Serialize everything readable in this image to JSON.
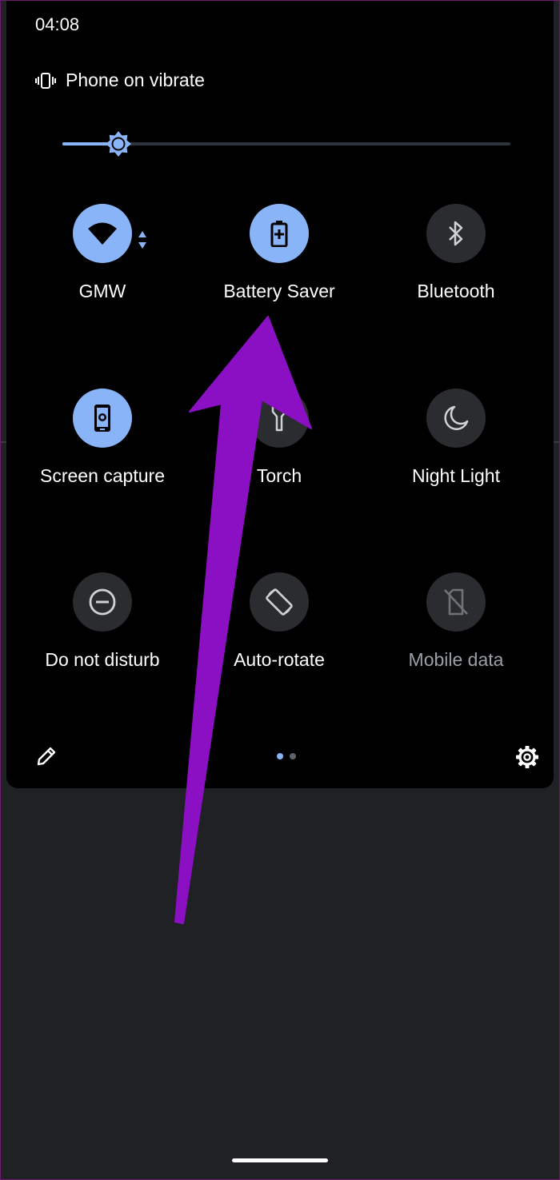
{
  "status_bar": {
    "time": "04:08"
  },
  "notice": {
    "text": "Phone on vibrate",
    "icon": "vibrate-icon"
  },
  "brightness": {
    "level_percent": 12.5
  },
  "tiles": [
    {
      "label": "GMW",
      "icon": "wifi-icon",
      "active": true
    },
    {
      "label": "Battery Saver",
      "icon": "battery-saver-icon",
      "active": true
    },
    {
      "label": "Bluetooth",
      "icon": "bluetooth-icon",
      "active": false
    },
    {
      "label": "Screen capture",
      "icon": "screen-capture-icon",
      "active": true
    },
    {
      "label": "Torch",
      "icon": "torch-icon",
      "active": false
    },
    {
      "label": "Night Light",
      "icon": "night-light-icon",
      "active": false
    },
    {
      "label": "Do not disturb",
      "icon": "do-not-disturb-icon",
      "active": false
    },
    {
      "label": "Auto-rotate",
      "icon": "auto-rotate-icon",
      "active": false
    },
    {
      "label": "Mobile data",
      "icon": "mobile-data-off-icon",
      "active": false,
      "disabled": true
    }
  ],
  "footer": {
    "edit_icon": "pencil-icon",
    "settings_icon": "gear-icon",
    "pages": 2,
    "current_page": 1
  },
  "colors": {
    "accent": "#8ab4f8",
    "panel": "#000000",
    "background": "#202124",
    "inactive_tile": "#2b2c2f",
    "annotation_arrow": "#8b10c4"
  }
}
